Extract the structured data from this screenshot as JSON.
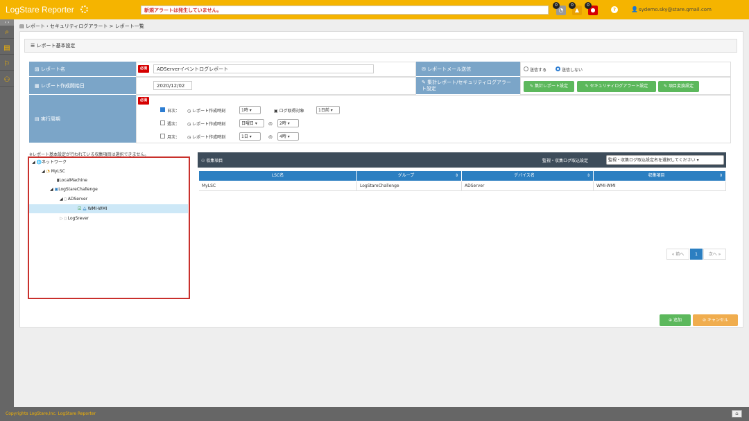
{
  "header": {
    "app_title": "LogStare Reporter",
    "alert_text": "新規アラートは発生していません。",
    "badges": [
      "0",
      "0",
      "0"
    ],
    "help": "?",
    "user_name": "sydemo.sky@stare.gmail.com"
  },
  "breadcrumb": "レポート・セキュリティログアラート > レポート一覧",
  "section_title": "レポート基本設定",
  "form": {
    "report_name_label": "レポート名",
    "required": "必須",
    "report_name_value": "ADServerイベントログレポート",
    "start_date_label": "レポート作成開始日",
    "start_date_value": "2020/12/02",
    "mail_label": "レポートメール送信",
    "mail_send": "送信する",
    "mail_nosend": "送信しない",
    "settings_label": "集計レポート/セキュリティログアラート設定",
    "btn_agg_report": "集計レポート設定",
    "btn_security_alert": "セキュリティログアラート設定",
    "btn_item_convert": "項目変換設定",
    "cycle_label": "実行周期",
    "daily": "日次：",
    "weekly": "週次：",
    "monthly": "月次：",
    "create_time": "レポート作成時刻",
    "daily_hour": "1時",
    "log_target": "ログ取得対象",
    "daily_target": "1日前",
    "weekly_day": "日曜日",
    "of": "の",
    "weekly_hour": "2時",
    "monthly_day": "1日",
    "monthly_hour": "4時"
  },
  "tree": {
    "note": "※レポート基本設定が行われている収集項目は選択できません。",
    "nodes": [
      "ネットワーク",
      "MyLSC",
      "LocalMachine",
      "LogStareChallenge",
      "ADServer",
      "WMI-WMI",
      "LogSrever"
    ]
  },
  "collect": {
    "title": "収集項目",
    "monitor_label": "監視・収集ログ取込設定",
    "monitor_select": "監視・収集ログ取込設定名を選択してください",
    "columns": [
      "LSC名",
      "グループ",
      "デバイス名",
      "収集項目"
    ],
    "rows": [
      [
        "MyLSC",
        "LogStareChallenge",
        "ADServer",
        "WMI-WMI"
      ]
    ],
    "prev": "« 前へ",
    "page": "1",
    "next": "次へ »"
  },
  "actions": {
    "add": "追加",
    "cancel": "キャンセル"
  },
  "footer": "Copyrights LogStare,Inc.  LogStare Reporter",
  "colors": {
    "header": "#f5b400",
    "label_blue": "#7ba5c8",
    "table_head": "#2c7fc1",
    "green": "#5cb85c",
    "orange": "#f0ad4e",
    "required": "#d60000"
  }
}
